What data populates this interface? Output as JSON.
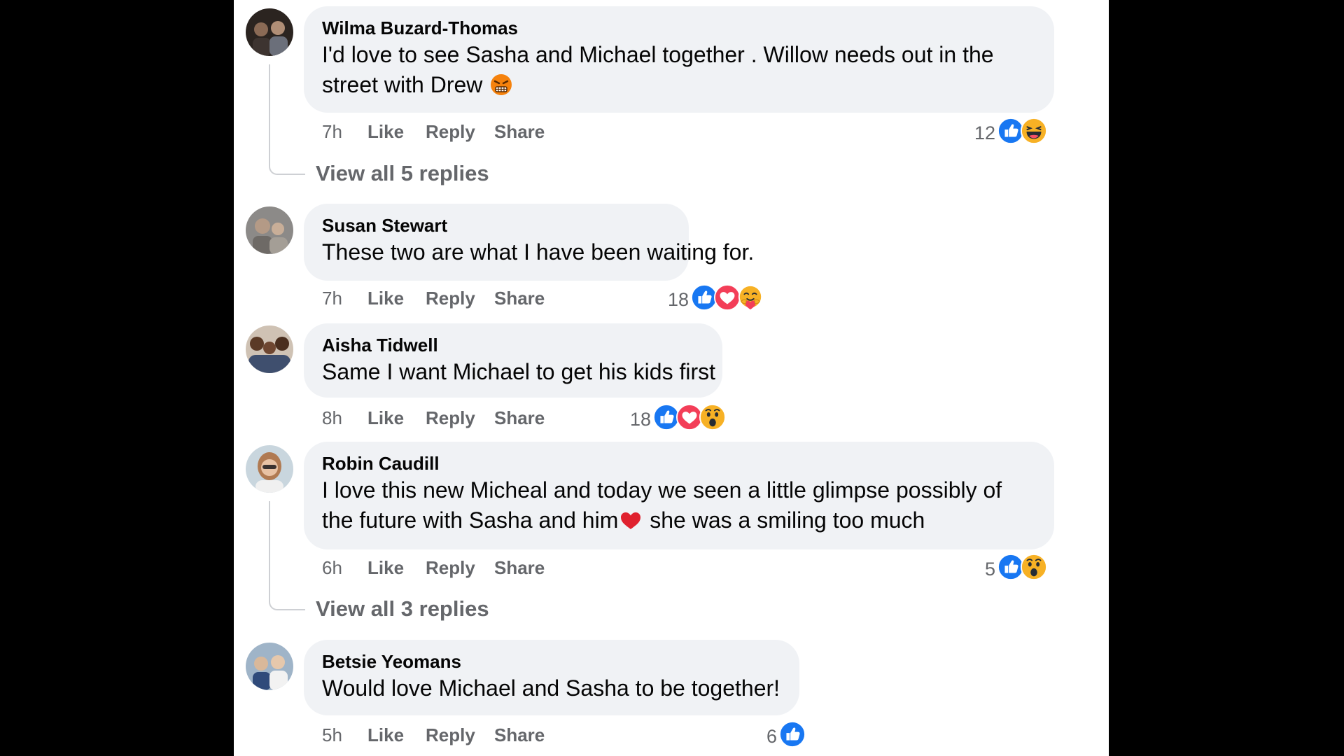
{
  "comments": [
    {
      "author": "Wilma Buzard-Thomas",
      "line1": "I'd love to see Sasha and Michael together . Willow needs out in the",
      "line2": "street with Drew",
      "inline_emoji": "angry-face-emoji",
      "time": "7h",
      "like": "Like",
      "reply": "Reply",
      "share": "Share",
      "reaction_count": "12",
      "reactions": [
        "like-reaction-icon",
        "haha-reaction-icon"
      ],
      "view_replies": "View all 5 replies"
    },
    {
      "author": "Susan Stewart",
      "line1": "These two are what I have been waiting for.",
      "time": "7h",
      "like": "Like",
      "reply": "Reply",
      "share": "Share",
      "reaction_count": "18",
      "reactions": [
        "like-reaction-icon",
        "love-reaction-icon",
        "care-reaction-icon"
      ]
    },
    {
      "author": "Aisha Tidwell",
      "line1": "Same I want Michael to get his kids first",
      "time": "8h",
      "like": "Like",
      "reply": "Reply",
      "share": "Share",
      "reaction_count": "18",
      "reactions": [
        "like-reaction-icon",
        "love-reaction-icon",
        "wow-reaction-icon"
      ]
    },
    {
      "author": "Robin Caudill",
      "line1": "I love this new Micheal and today we seen a little glimpse possibly of",
      "line2a": "the future with Sasha and him",
      "line2b": " she was a smiling too much",
      "inline_emoji": "red-heart-emoji",
      "time": "6h",
      "like": "Like",
      "reply": "Reply",
      "share": "Share",
      "reaction_count": "5",
      "reactions": [
        "like-reaction-icon",
        "wow-reaction-icon"
      ],
      "view_replies": "View all 3 replies"
    },
    {
      "author": "Betsie Yeomans",
      "line1": "Would love Michael and Sasha to be together!",
      "time": "5h",
      "like": "Like",
      "reply": "Reply",
      "share": "Share",
      "reaction_count": "6",
      "reactions": [
        "like-reaction-icon"
      ]
    }
  ],
  "colors": {
    "bubble": "#f0f2f5",
    "secondary_text": "#65676b",
    "like_blue": "#1877f2",
    "love_red": "#f33e58",
    "emoji_yellow": "#f7b125"
  }
}
